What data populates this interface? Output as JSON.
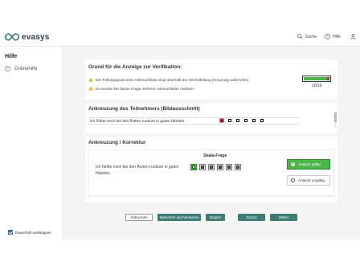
{
  "app": {
    "name": "evasys"
  },
  "header": {
    "search_label": "Suche",
    "help_label": "Hilfe"
  },
  "sidebar": {
    "title": "Hilfe",
    "items": [
      {
        "label": "Onlinehilfe",
        "icon": "help-circle-icon"
      }
    ],
    "expand_checkbox": {
      "label": "Dauerhaft ausklappen",
      "checked": true
    }
  },
  "verification": {
    "heading": "Grund für die Anzeige zur Verifikation:",
    "reasons": [
      "Der Füllungsgrad eines Ankreuzfeldes liegt oberhalb der Höchstfüllung (Kreuzung widerrufen).",
      "Es wurden bei dieser Frage mehrere Ankreuzfelder markiert."
    ],
    "fill_level_label": "10/10",
    "fill_level_fraction": 1.0
  },
  "participant": {
    "heading": "Ankreuzung des Teilnehmers (Bildausschnitt)",
    "snippet_text": "Ich fühlte mich bei den Ärzten rundum in guten Händen."
  },
  "correction": {
    "heading": "Ankreuzung / Korrektur",
    "scale_label": "Skala-Frage",
    "question": "Ich fühlte mich bei den Ärzten rundum in guten Händen.",
    "scale_count": 6,
    "selected_index": 0,
    "valid_label": "Antwort gültig",
    "invalid_label": "Antwort ungültig",
    "selected_choice": "valid"
  },
  "buttons": {
    "cancel": "Abbrechen",
    "save_exit": "Speichern und Verlassen",
    "start": "Beginn",
    "back": "Zurück",
    "next": "Weiter"
  },
  "colors": {
    "accent": "#3f7c73",
    "valid": "#4bb44b",
    "warning": "#e8a500",
    "error": "#c62828"
  }
}
